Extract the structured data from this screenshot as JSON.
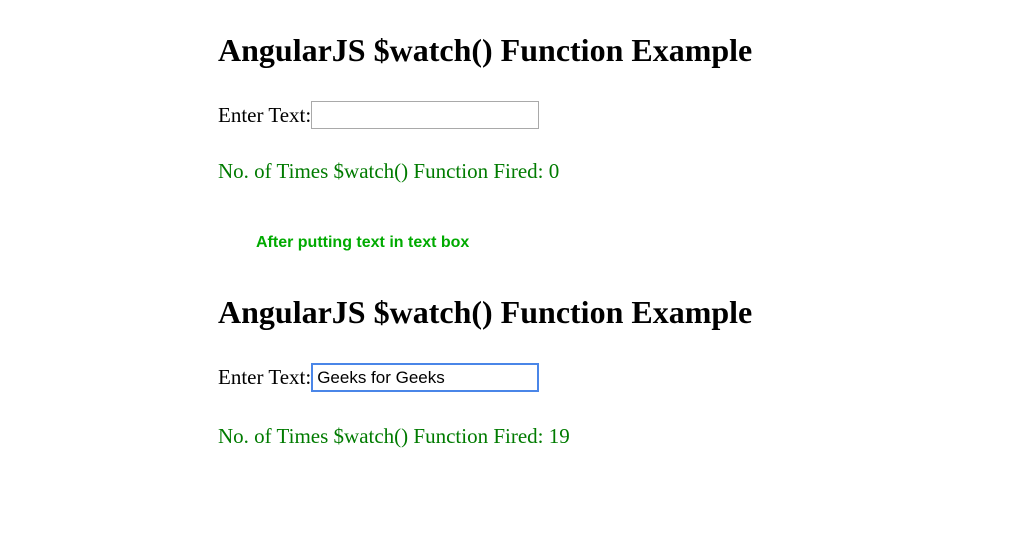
{
  "section1": {
    "heading": "AngularJS $watch() Function Example",
    "label": "Enter Text:",
    "input_value": "",
    "status_prefix": "No. of Times $watch() Function Fired: ",
    "status_count": "0"
  },
  "annotation": "After putting text in text box",
  "section2": {
    "heading": "AngularJS $watch() Function Example",
    "label": "Enter Text:",
    "input_value": "Geeks for Geeks",
    "status_prefix": "No. of Times $watch() Function Fired: ",
    "status_count": "19"
  }
}
